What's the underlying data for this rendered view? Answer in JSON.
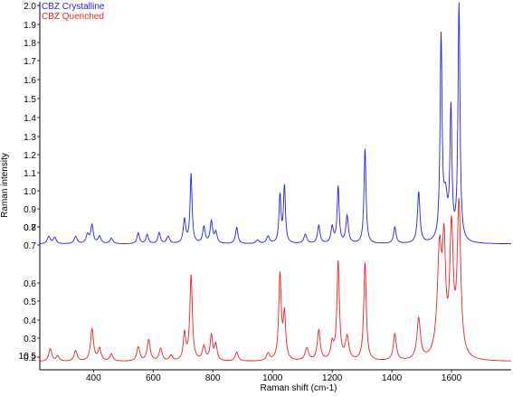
{
  "chart_data": {
    "type": "line",
    "xlabel": "Raman shift (cm-1)",
    "ylabel": "Raman intensity",
    "xlim": [
      220,
      1800
    ],
    "x_ticks": [
      400,
      600,
      800,
      1000,
      1200,
      1400,
      1600
    ],
    "y_tick_labels": [
      "2.0",
      "1.9",
      "1.8",
      "1.7",
      "1.6",
      "1.5",
      "1.4",
      "1.3",
      "1.2",
      "1.1",
      "1.0",
      "0.9",
      "0.8",
      "0.7",
      "0.7",
      "0.6",
      "0.5",
      "0.4",
      "0.3",
      "0.2",
      "0.1",
      "10 5"
    ],
    "grid": false,
    "legend_position": "top-left",
    "series": [
      {
        "name": "CBZ Crystalline",
        "color": "#2222dd",
        "baseline": 0.69,
        "scale": 1.0,
        "peaks": [
          [
            250,
            0.04,
            6
          ],
          [
            270,
            0.035,
            6
          ],
          [
            340,
            0.04,
            6
          ],
          [
            380,
            0.05,
            6
          ],
          [
            395,
            0.1,
            5
          ],
          [
            420,
            0.04,
            6
          ],
          [
            460,
            0.03,
            6
          ],
          [
            550,
            0.06,
            5
          ],
          [
            580,
            0.05,
            5
          ],
          [
            620,
            0.06,
            5
          ],
          [
            650,
            0.04,
            6
          ],
          [
            705,
            0.13,
            5
          ],
          [
            727,
            0.38,
            4
          ],
          [
            770,
            0.09,
            5
          ],
          [
            795,
            0.12,
            5
          ],
          [
            810,
            0.06,
            5
          ],
          [
            880,
            0.09,
            5
          ],
          [
            950,
            0.02,
            6
          ],
          [
            985,
            0.04,
            6
          ],
          [
            1025,
            0.26,
            4
          ],
          [
            1040,
            0.31,
            4
          ],
          [
            1110,
            0.05,
            6
          ],
          [
            1155,
            0.1,
            5
          ],
          [
            1200,
            0.09,
            5
          ],
          [
            1220,
            0.31,
            4
          ],
          [
            1250,
            0.15,
            5
          ],
          [
            1310,
            0.52,
            4
          ],
          [
            1410,
            0.09,
            5
          ],
          [
            1490,
            0.28,
            5
          ],
          [
            1565,
            1.1,
            4
          ],
          [
            1580,
            0.22,
            8
          ],
          [
            1598,
            0.7,
            4
          ],
          [
            1625,
            1.3,
            4
          ]
        ]
      },
      {
        "name": "CBZ Quenched",
        "color": "#ee2222",
        "baseline": 0.05,
        "scale": 1.0,
        "peaks": [
          [
            255,
            0.07,
            6
          ],
          [
            280,
            0.03,
            6
          ],
          [
            340,
            0.06,
            6
          ],
          [
            395,
            0.18,
            6
          ],
          [
            420,
            0.07,
            6
          ],
          [
            460,
            0.04,
            6
          ],
          [
            550,
            0.08,
            6
          ],
          [
            585,
            0.12,
            6
          ],
          [
            625,
            0.07,
            6
          ],
          [
            660,
            0.03,
            6
          ],
          [
            705,
            0.15,
            5
          ],
          [
            727,
            0.48,
            5
          ],
          [
            770,
            0.08,
            6
          ],
          [
            795,
            0.14,
            5
          ],
          [
            810,
            0.09,
            5
          ],
          [
            880,
            0.05,
            6
          ],
          [
            985,
            0.04,
            6
          ],
          [
            1025,
            0.48,
            5
          ],
          [
            1040,
            0.25,
            5
          ],
          [
            1115,
            0.07,
            7
          ],
          [
            1155,
            0.17,
            6
          ],
          [
            1200,
            0.09,
            6
          ],
          [
            1220,
            0.55,
            5
          ],
          [
            1250,
            0.13,
            7
          ],
          [
            1310,
            0.55,
            5
          ],
          [
            1410,
            0.15,
            6
          ],
          [
            1490,
            0.23,
            7
          ],
          [
            1560,
            0.6,
            9
          ],
          [
            1575,
            0.55,
            6
          ],
          [
            1600,
            0.7,
            7
          ],
          [
            1625,
            0.85,
            7
          ]
        ]
      }
    ]
  }
}
